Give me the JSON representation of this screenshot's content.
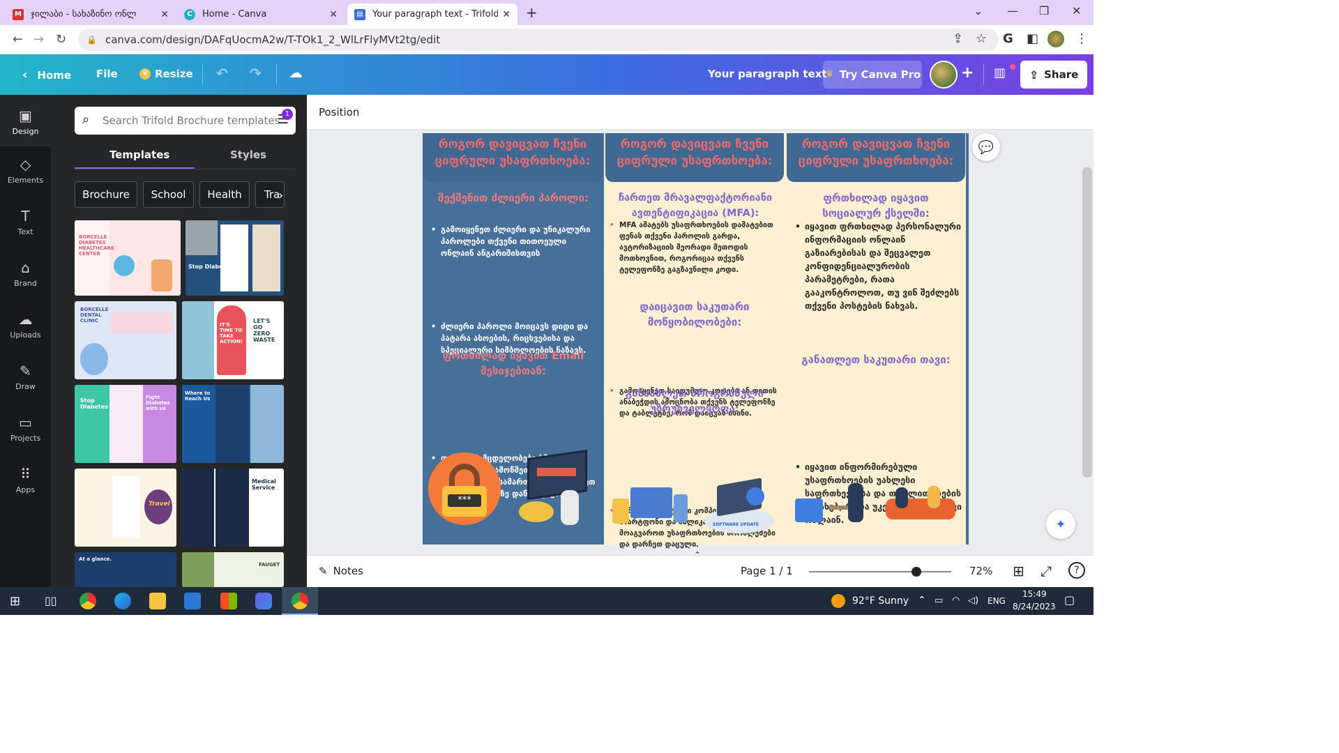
{
  "browser": {
    "tabs": [
      {
        "title": "ჯილაბი - სახაზინო ონლ",
        "icon": "gmail-icon"
      },
      {
        "title": "Home - Canva",
        "icon": "canva-icon"
      },
      {
        "title": "Your paragraph text - Trifold Broc",
        "icon": "canva-doc-icon"
      }
    ],
    "url": "canva.com/design/DAFqUocmA2w/T-TOk1_2_WlLrFlyMVt2tg/edit"
  },
  "canva_top": {
    "home": "Home",
    "file": "File",
    "resize": "Resize",
    "doc_title": "Your paragraph text",
    "try_pro": "Try Canva Pro",
    "share": "Share"
  },
  "rail": [
    {
      "label": "Design",
      "icon": "design-icon"
    },
    {
      "label": "Elements",
      "icon": "elements-icon"
    },
    {
      "label": "Text",
      "icon": "text-icon"
    },
    {
      "label": "Brand",
      "icon": "brand-icon"
    },
    {
      "label": "Uploads",
      "icon": "uploads-icon"
    },
    {
      "label": "Draw",
      "icon": "draw-icon"
    },
    {
      "label": "Projects",
      "icon": "projects-icon"
    },
    {
      "label": "Apps",
      "icon": "apps-icon"
    }
  ],
  "panel": {
    "search_placeholder": "Search Trifold Brochure templates",
    "filter_badge": "1",
    "tabs": [
      "Templates",
      "Styles"
    ],
    "chips": [
      "Brochure",
      "School",
      "Health",
      "Tra"
    ],
    "thumb_labels": {
      "t1": "BORCELLE DIABETES HEALTHCARE CENTER",
      "t2": "Stop Diabetes",
      "t3": "BORCELLE DENTAL CLINIC",
      "t4": "IT'S TIME TO TAKE ACTION!",
      "t4b": "LET'S GO ZERO WASTE",
      "t5": "Stop Diabetes",
      "t5b": "Fight Diabetes with us",
      "t6": "Where to Reach Us",
      "t7": "Travel",
      "t8": "Medical Service",
      "t9": "At a glance.",
      "t10": "FAUGET"
    }
  },
  "toolbar": {
    "position": "Position"
  },
  "brochure": {
    "header": "როგორ დავიცვათ ჩვენი ციფრული უსაფრთხოება:",
    "col1": {
      "title1": "შექმენით ძლიერი პაროლი:",
      "b1": "გამოიყენეთ ძლიერი და უნიკალური პაროლები თქვენი თითოეული ონლაინ ანგარიშისთვის",
      "b2": "ძლიერი პაროლი მოიცავს დიდი და პატარა ასოების, რიცხვებისა და სპეციალური სიმბოლოების ნაზავს.",
      "title2": "ფრთხილად იყავით Email მესიჯებთან:",
      "b3": "ფიშინგის მცდელობები ხშირია, ამიტომ გადაამოწმეთ გამგზავნის ელფოსტის მისამართი და მოერიდეთ უცნობ ბმულებზე დაწკაპუნებას."
    },
    "col2": {
      "title1": "ჩართეთ მრავალფაქტორიანი ავთენტიფიკაცია (MFA):",
      "b1": "MFA ამატებს უსაფრთხოების დამატებით ფენას თქვენი პაროლის გარდა, ავტორიზაციის მეორადი მეთოდის მოთხოვნით, როგორიცაა თქვენს ტელეფონზე გაგზავნილი კოდი.",
      "title2": "დაიცავით საკუთარი მოწყობილობები:",
      "b2": "გამოიყენეთ საიდუმლო კოდები ან თითის ანაბეჭდის ამოცნობა თქვენს ტელეფონზე და ტაბლეტზე, რომ დაიცვან ისინი.",
      "title3": "განაახლეთ პროგრამული უზრუნველყოფა:",
      "b3": "განაახლეთ თქვენი კომპიუტერი, სმარტფონი და აპლიკაციები, რათა მოაგვაროთ უსაფრთხოების პრობლემები და დარჩეთ დაცული.",
      "ill_caption": "SOFTWARE UPDATE"
    },
    "col3": {
      "title1": "ფრთხილად იყავით სოციალურ ქსელში:",
      "b1": "იყავით ფრთხილად პერსონალური ინფორმაციის ონლაინ გაზიარებისას და შეცვალეთ კონფიდენციალურობის პარამეტრები, რათა გააკონტროლოთ, თუ ვინ შეძლებს თქვენი პოსტების ნახვას.",
      "title2": "განათლეთ საკუთარი თავი:",
      "b2": "იყავით ინფორმირებული უსაფრთხოების უახლესი საფრთხეებისა და თაღლითობების შესახებ, რათა უკეთ დაიცვათ თავი ონლაინ."
    },
    "lock_code": "***"
  },
  "bottombar": {
    "notes": "Notes",
    "page": "Page 1 / 1",
    "zoom_percent": 72,
    "zoom_label": "72%"
  },
  "taskbar": {
    "weather": "92°F  Sunny",
    "lang": "ENG",
    "time": "15:49",
    "date": "8/24/2023"
  },
  "colors": {
    "accent": "#7d2ae8",
    "brochure_blue": "#466f9a",
    "brochure_cream": "#fdefd1",
    "heading_red": "#ee7b7b",
    "heading_purple": "#7f68c9"
  }
}
